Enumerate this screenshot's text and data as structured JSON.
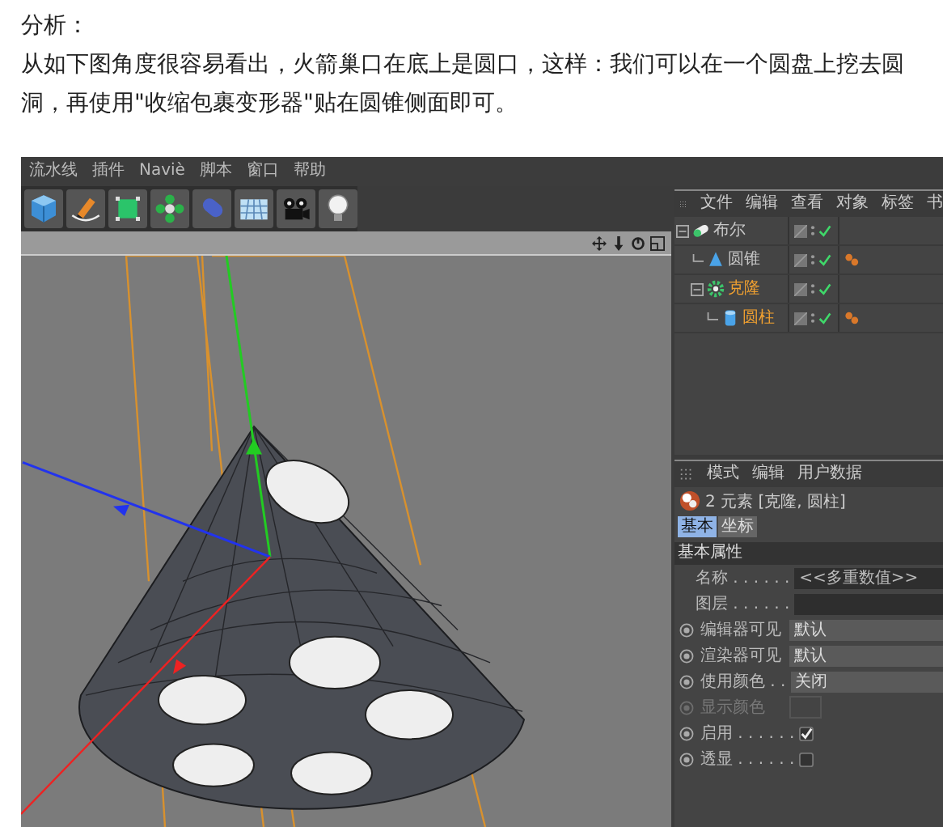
{
  "post": {
    "heading": "分析：",
    "paragraph": "从如下图角度很容易看出，火箭巢口在底上是圆口，这样：我们可以在一个圆盘上挖去圆洞，再使用\"收缩包裹变形器\"贴在圆锥侧面即可。"
  },
  "app": {
    "menu": [
      "流水线",
      "插件",
      "Naviè",
      "脚本",
      "窗口",
      "帮助"
    ],
    "object_manager": {
      "menu": [
        "文件",
        "编辑",
        "查看",
        "对象",
        "标签",
        "书"
      ],
      "objects": [
        {
          "name": "布尔",
          "kind": "boolean",
          "selected": false,
          "enabled": true,
          "tag": false,
          "children": [
            {
              "name": "圆锥",
              "kind": "cone",
              "selected": false,
              "enabled": true,
              "tag": true
            },
            {
              "name": "克隆",
              "kind": "cloner",
              "selected": true,
              "enabled": true,
              "tag": false,
              "children": [
                {
                  "name": "圆柱",
                  "kind": "cylinder",
                  "selected": true,
                  "enabled": true,
                  "tag": true
                }
              ]
            }
          ]
        }
      ]
    },
    "attributes": {
      "menu": [
        "模式",
        "编辑",
        "用户数据"
      ],
      "title": "2 元素 [克隆, 圆柱]",
      "tabs": [
        {
          "label": "基本",
          "selected": true
        },
        {
          "label": "坐标",
          "selected": false
        }
      ],
      "section": "基本属性",
      "rows": [
        {
          "kind": "field",
          "label": "名称 . . . . . .",
          "value": "<<多重数值>>"
        },
        {
          "kind": "field",
          "label": "图层 . . . . . ."
        },
        {
          "kind": "dropdown",
          "label": "编辑器可见",
          "value": "默认"
        },
        {
          "kind": "dropdown",
          "label": "渲染器可见",
          "value": "默认"
        },
        {
          "kind": "dropdown",
          "label": "使用颜色 . .",
          "value": "关闭"
        },
        {
          "kind": "color",
          "label": "显示颜色",
          "disabled": true
        },
        {
          "kind": "checkbox",
          "label": "启用 . . . . . .",
          "checked": true
        },
        {
          "kind": "checkbox",
          "label": "透显 . . . . . .",
          "checked": false
        }
      ]
    }
  }
}
